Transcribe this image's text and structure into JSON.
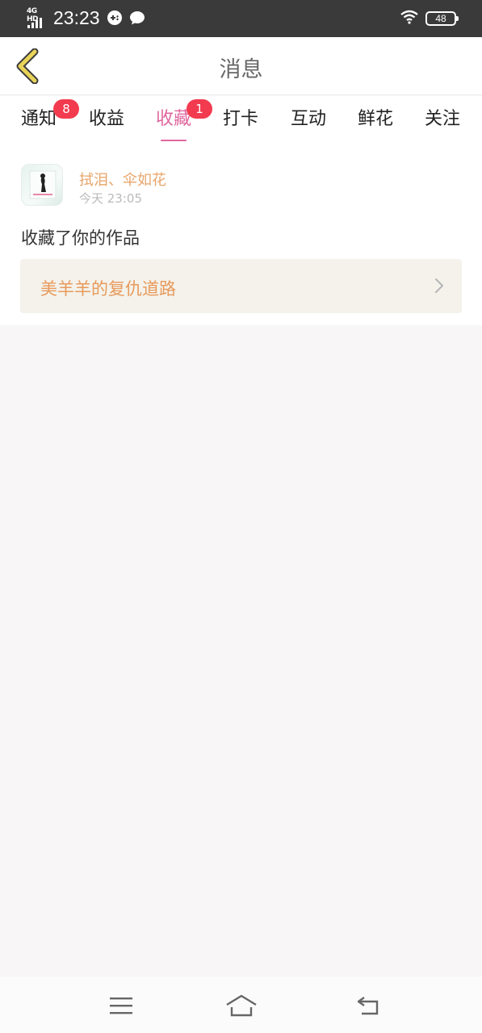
{
  "status_bar": {
    "network": "4G HD",
    "time": "23:23",
    "battery": "48",
    "icons": [
      "signal-icon",
      "game-icon",
      "chat-bubble-icon",
      "wifi-icon",
      "battery-icon"
    ]
  },
  "header": {
    "title": "消息",
    "back_icon": "chevron-left-icon"
  },
  "tabs": [
    {
      "label": "通知",
      "badge": "8",
      "active": false
    },
    {
      "label": "收益",
      "badge": null,
      "active": false
    },
    {
      "label": "收藏",
      "badge": "1",
      "active": true
    },
    {
      "label": "打卡",
      "badge": null,
      "active": false
    },
    {
      "label": "互动",
      "badge": null,
      "active": false
    },
    {
      "label": "鲜花",
      "badge": null,
      "active": false
    },
    {
      "label": "关注",
      "badge": null,
      "active": false
    }
  ],
  "message": {
    "sender": "拭泪、伞如花",
    "time": "今天 23:05",
    "action": "收藏了你的作品",
    "work_title": "美羊羊的复仇道路"
  },
  "nav_bar": {
    "icons": [
      "menu-icon",
      "home-icon",
      "back-icon"
    ]
  },
  "colors": {
    "accent": "#e0679f",
    "badge": "#f23b4f",
    "sender": "#e8a56a",
    "work_title": "#e89a5c",
    "back_arrow": "#e9d35a"
  }
}
